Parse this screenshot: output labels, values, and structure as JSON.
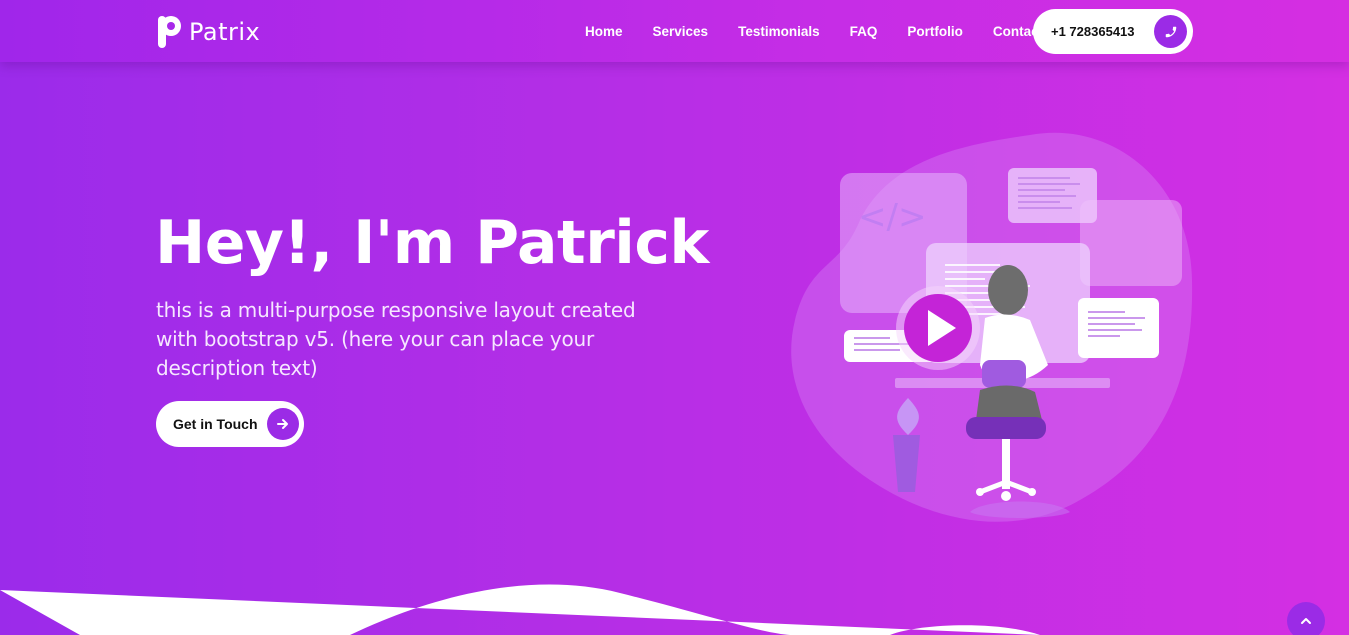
{
  "brand": {
    "name": "Patrix"
  },
  "nav": {
    "items": [
      {
        "label": "Home"
      },
      {
        "label": "Services"
      },
      {
        "label": "Testimonials"
      },
      {
        "label": "FAQ"
      },
      {
        "label": "Portfolio"
      },
      {
        "label": "Contacts"
      }
    ],
    "phone": "+1 728365413",
    "phone_icon": "phone-icon"
  },
  "hero": {
    "title": "Hey!, I'm Patrick",
    "description": "this is a multi-purpose responsive layout created with bootstrap v5. (here your can place your description text)",
    "cta_label": "Get in Touch",
    "cta_icon": "arrow-right-icon"
  },
  "illustration": {
    "code_tag": "</>"
  },
  "colors": {
    "accent": "#9b2be6",
    "gradient_start": "#9b2bea",
    "gradient_end": "#d42fe3"
  }
}
